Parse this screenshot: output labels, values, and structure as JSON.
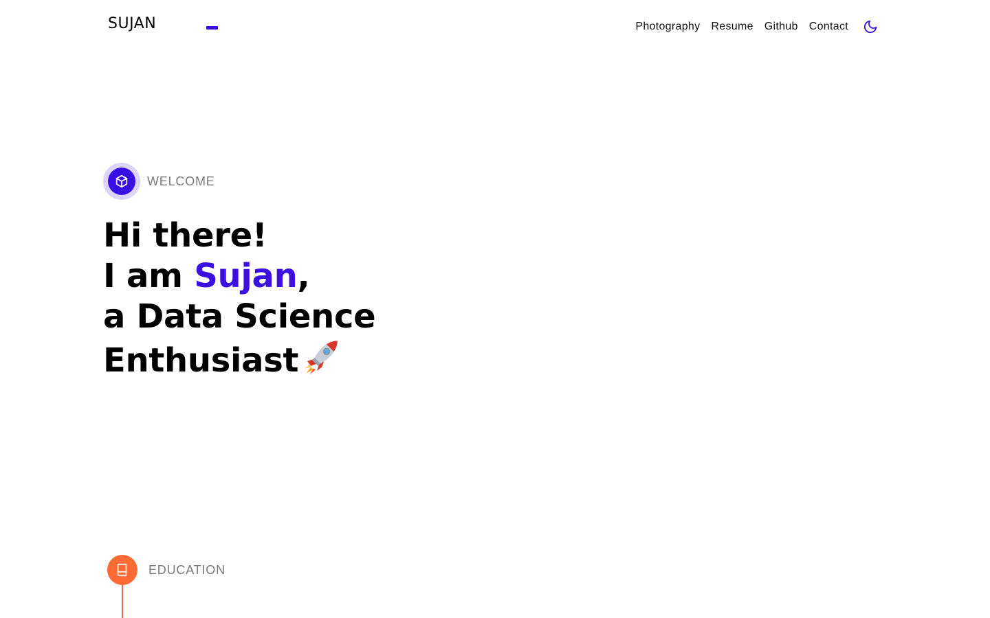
{
  "header": {
    "logo": "SUJAN",
    "nav": [
      {
        "label": "Photography"
      },
      {
        "label": "Resume"
      },
      {
        "label": "Github"
      },
      {
        "label": "Contact"
      }
    ],
    "theme_toggle_icon": "moon-icon"
  },
  "hero": {
    "tag_label": "WELCOME",
    "tag_icon": "cube-icon",
    "line1": "Hi there!",
    "line2_prefix": "I am ",
    "line2_name": "Sujan",
    "line2_suffix": ",",
    "line3": "a Data Science",
    "line4": "Enthusiast",
    "emoji_icon": "rocket-icon"
  },
  "education": {
    "tag_label": "EDUCATION",
    "tag_icon": "book-icon"
  },
  "colors": {
    "accent": "#3b0fe0",
    "accent_light": "#dcd4fb",
    "education": "#ff6a35",
    "muted_text": "#7a7a7a"
  }
}
